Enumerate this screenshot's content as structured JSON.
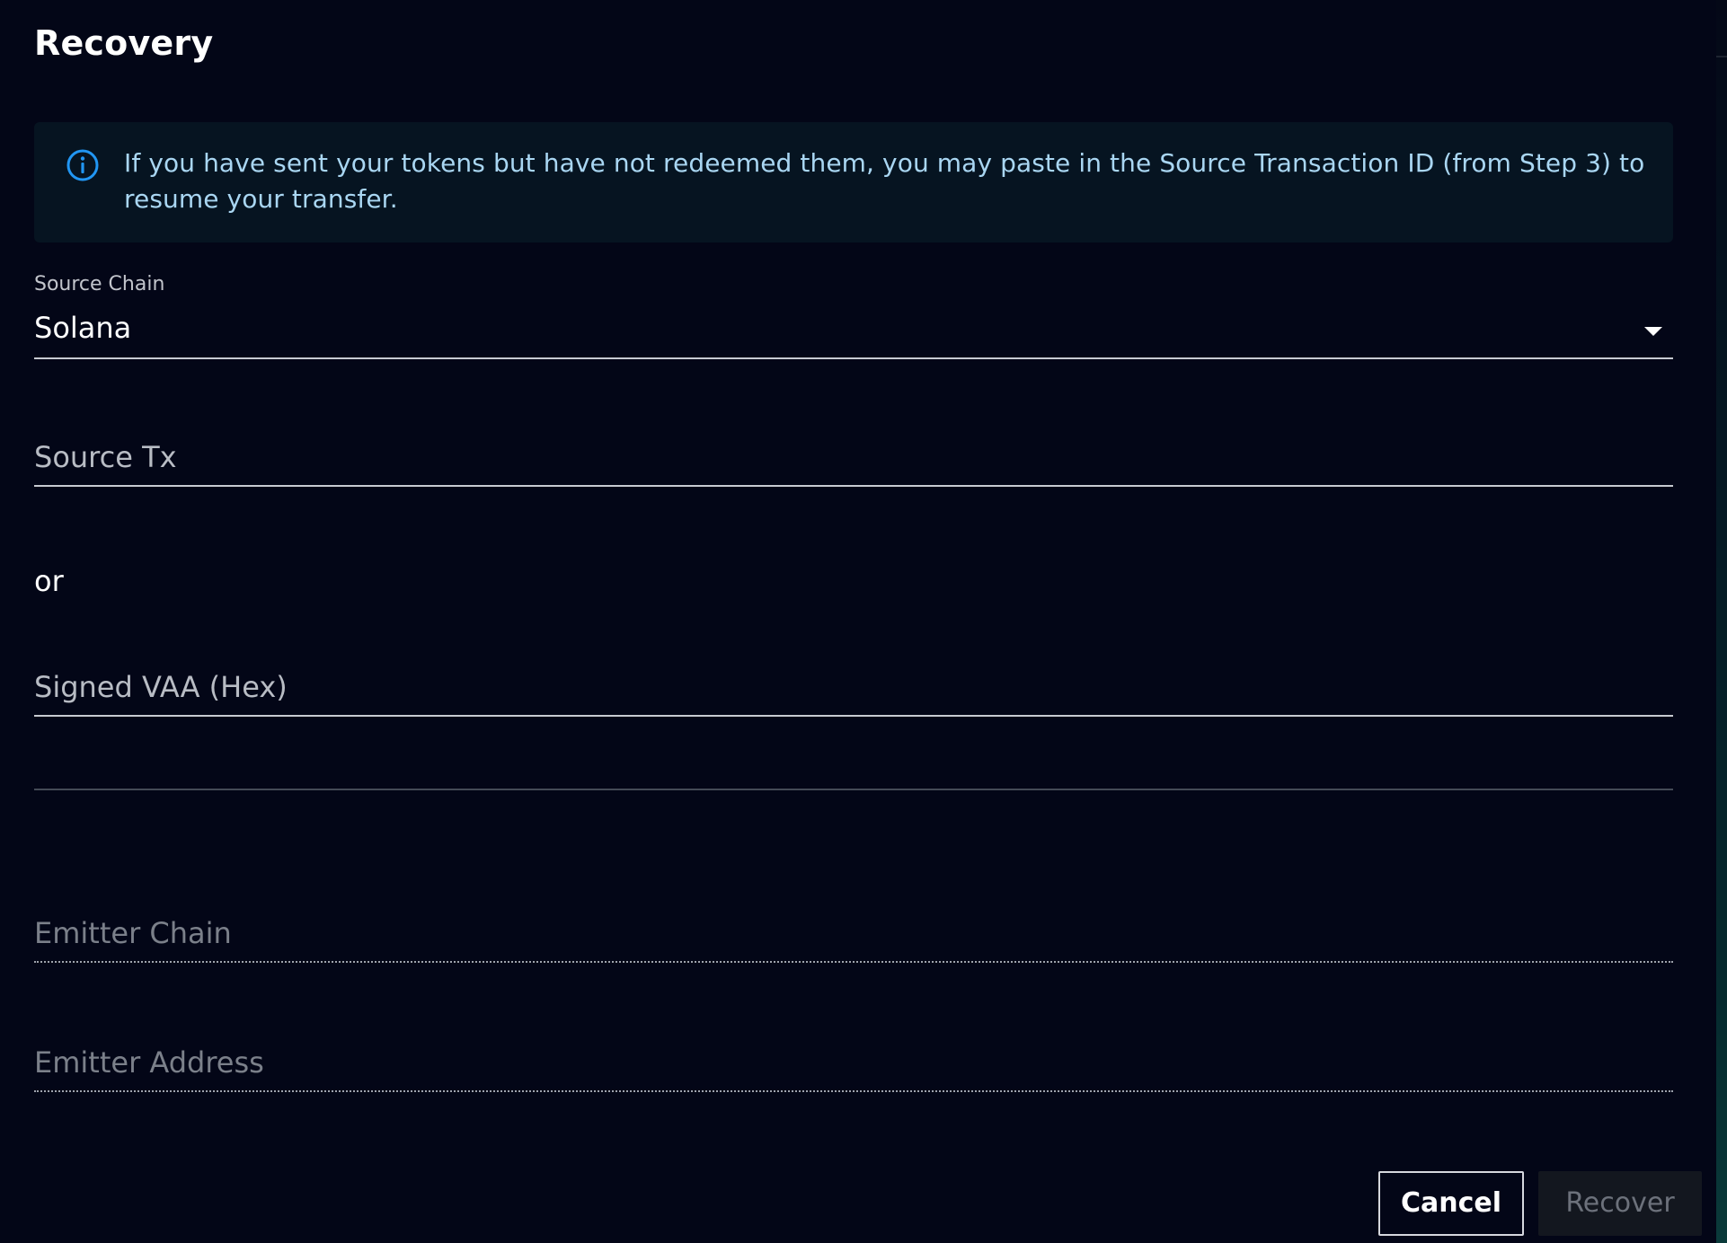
{
  "dialog": {
    "title": "Recovery",
    "alert": {
      "icon": "info-icon",
      "message": "If you have sent your tokens but have not redeemed them, you may paste in the Source Transaction ID (from Step 3) to resume your transfer.",
      "color": "#a9d6f2"
    },
    "source_chain": {
      "label": "Source Chain",
      "selected": "Solana",
      "icon": "chevron-down-icon"
    },
    "source_tx": {
      "placeholder": "Source Tx",
      "value": ""
    },
    "separator_text": "or",
    "signed_vaa": {
      "placeholder": "Signed VAA (Hex)",
      "value": ""
    },
    "emitter_chain": {
      "placeholder": "Emitter Chain"
    },
    "emitter_address": {
      "placeholder": "Emitter Address"
    },
    "buttons": {
      "cancel": "Cancel",
      "recover": "Recover"
    }
  },
  "colors": {
    "background": "#030617",
    "alert_background": "#061421",
    "info_accent": "#2196f3"
  }
}
